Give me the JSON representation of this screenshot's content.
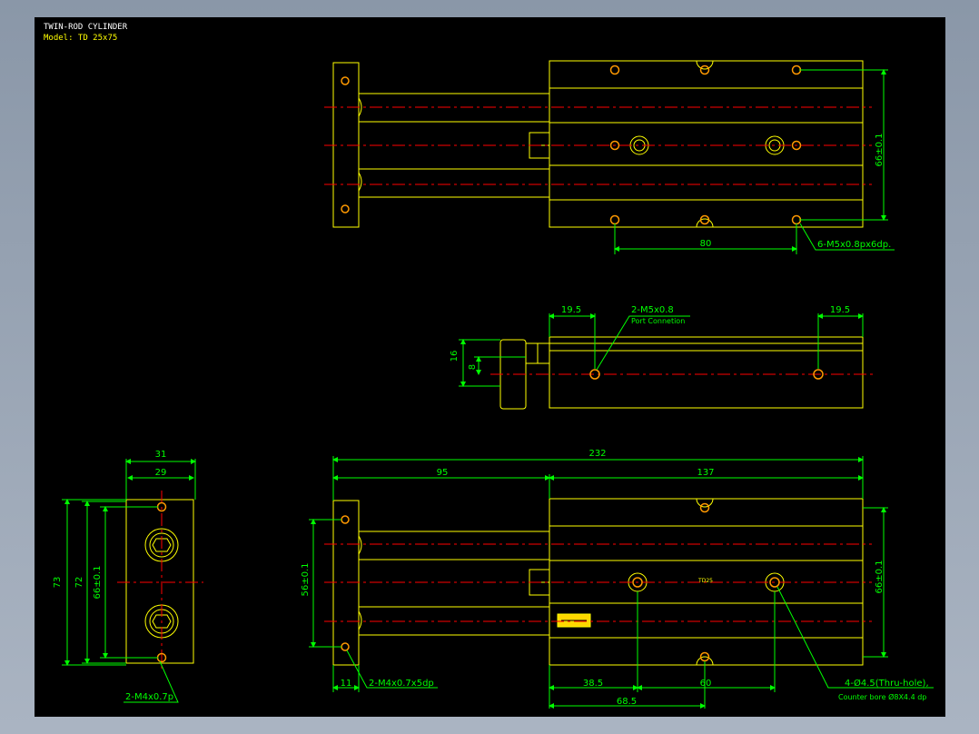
{
  "title": {
    "line1": "TWIN-ROD CYLINDER",
    "line2": "Model: TD 25x75"
  },
  "colors": {
    "background": "#000000",
    "outline": "#ffff00",
    "centerline": "#ff0000",
    "dimension": "#00ff00",
    "hole": "#ff9900",
    "title": "#ffffff"
  },
  "top_view": {
    "dim_height": "66±0.1",
    "dim_spacing": "80",
    "note_holes": "6-M5x0.8px6dp."
  },
  "side_view": {
    "dim_left": "19.5",
    "dim_right": "19.5",
    "port_note": "2-M5x0.8",
    "port_sub": "Port Connetion",
    "dim_16": "16",
    "dim_8": "8"
  },
  "end_view": {
    "dim_31": "31",
    "dim_29": "29",
    "dim_73": "73",
    "dim_72": "72",
    "dim_66": "66±0.1",
    "note_holes": "2-M4x0.7p"
  },
  "front_view": {
    "dim_total": "232",
    "dim_95": "95",
    "dim_137": "137",
    "dim_56": "56±0.1",
    "dim_66": "66±0.1",
    "dim_11": "11",
    "note_plate": "2-M4x0.7x5dp",
    "dim_38_5": "38.5",
    "dim_60": "60",
    "dim_68_5": "68.5",
    "body_label": "TD25",
    "note_thru": "4-Ø4.5(Thru-hole),",
    "note_bore": "Counter bore Ø8X4.4 dp"
  }
}
